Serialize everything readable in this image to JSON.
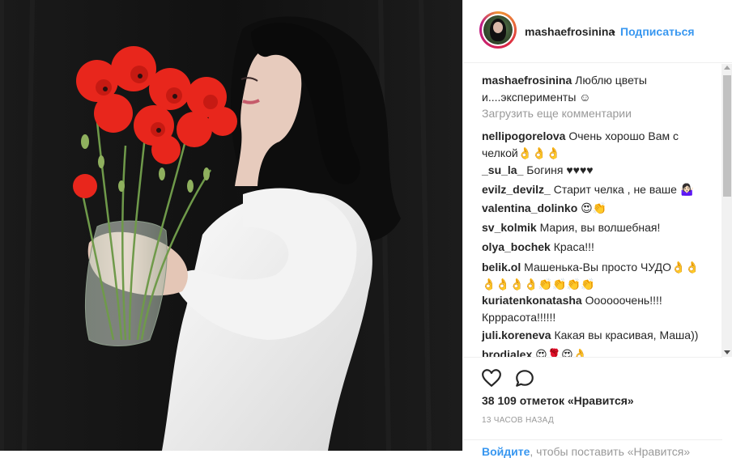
{
  "post": {
    "username": "mashaefrosinina",
    "dot": "•",
    "follow_label": "Подписаться"
  },
  "caption": {
    "username": "mashaefrosinina",
    "text": "Люблю цветы и....эксперименты ☺"
  },
  "load_more_label": "Загрузить еще комментарии",
  "comments": [
    {
      "user": "nellipogorelova",
      "text": "Очень хорошо Вам с челкой👌👌👌"
    },
    {
      "user": "_su_la_",
      "text": "Богиня ♥♥♥♥"
    },
    {
      "user": "evilz_devilz_",
      "text": "Старит челка , не ваше 🤷🏻‍♀️"
    },
    {
      "user": "valentina_dolinko",
      "text": "😍👏"
    },
    {
      "user": "sv_kolmik",
      "text": "Мария, вы волшебная!"
    },
    {
      "user": "olya_bochek",
      "text": "Краса!!!"
    },
    {
      "user": "belik.ol",
      "text": "Машенька-Вы просто ЧУДО👌👌👌👌👌👌👏👏👏👏"
    },
    {
      "user": "kuriatenkonatasha",
      "text": "Оооооочень!!!! Крррасота!!!!!!"
    },
    {
      "user": "juli.koreneva",
      "text": "Какая вы красивая, Маша))"
    },
    {
      "user": "brodialex",
      "text": "😍🌹😍👌"
    }
  ],
  "likes_text": "38 109 отметок «Нравится»",
  "time_text": "13 часов назад",
  "login": {
    "link": "Войдите",
    "text": ", чтобы поставить «Нравится»"
  },
  "icons": {
    "like": "heart-icon",
    "comment": "comment-icon",
    "scroll_up": "arrow-up-icon",
    "scroll_down": "arrow-down-icon"
  },
  "colors": {
    "link_blue": "#3897f0",
    "text": "#262626",
    "muted": "#999999",
    "poppy_red": "#e8261c"
  }
}
